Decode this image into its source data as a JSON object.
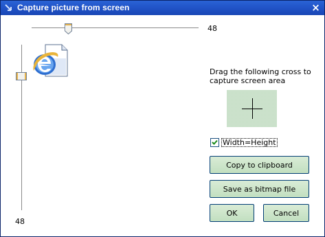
{
  "window": {
    "title": "Capture picture from screen",
    "close_glyph": "×",
    "app_icon": "arrow-icon"
  },
  "size_slider_horizontal": {
    "value_label": "48",
    "position_fraction": 0.22
  },
  "size_slider_vertical": {
    "value_label": "48",
    "position_fraction": 0.18
  },
  "preview": {
    "icon": "internet-explorer-document-icon"
  },
  "instructions": "Drag the following cross  to capture screen area",
  "cross_area": {
    "icon": "crosshair-icon"
  },
  "width_equals_height": {
    "label": "Width=Height",
    "checked": true
  },
  "buttons": {
    "copy": "Copy to clipboard",
    "save": "Save as bitmap file",
    "ok": "OK",
    "cancel": "Cancel"
  },
  "colors": {
    "titlebar": "#1f50c4",
    "button_face": "#c8e2c6",
    "button_border": "#003c74",
    "cross_area": "#d6e8d6"
  }
}
